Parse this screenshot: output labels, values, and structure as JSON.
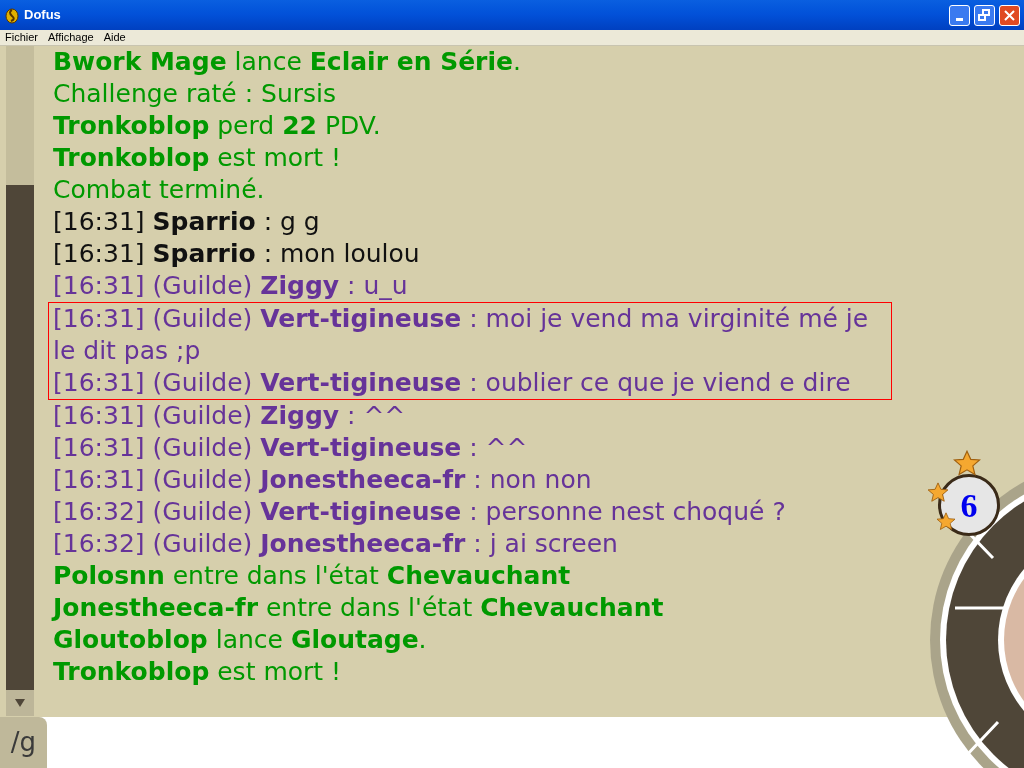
{
  "window": {
    "title": "Dofus"
  },
  "menu": [
    "Fichier",
    "Affichage",
    "Aide"
  ],
  "chat": [
    {
      "kind": "system",
      "text": "**Bwork Mage** lance **Eclair en Série**.",
      "highlighted": false
    },
    {
      "kind": "system",
      "text": "Challenge raté : Sursis",
      "highlighted": false
    },
    {
      "kind": "system",
      "text": "**Tronkoblop** perd **22** PDV.",
      "highlighted": false
    },
    {
      "kind": "system",
      "text": "**Tronkoblop** est mort !",
      "highlighted": false
    },
    {
      "kind": "system",
      "text": "Combat terminé.",
      "highlighted": false
    },
    {
      "kind": "general",
      "text": "[16:31] **Sparrio** : g g",
      "highlighted": false
    },
    {
      "kind": "general",
      "text": "[16:31] **Sparrio** : mon loulou",
      "highlighted": false
    },
    {
      "kind": "guild",
      "text": "[16:31] (Guilde) **Ziggy** : u_u",
      "highlighted": false
    },
    {
      "kind": "guild",
      "text": "[16:31] (Guilde) **Vert-tigineuse** : moi je vend ma virginité mé je le dit pas ;p",
      "highlighted": true
    },
    {
      "kind": "guild",
      "text": "[16:31] (Guilde) **Vert-tigineuse** : oublier ce que je viend e dire",
      "highlighted": true
    },
    {
      "kind": "guild",
      "text": "[16:31] (Guilde) **Ziggy** : ^^",
      "highlighted": false
    },
    {
      "kind": "guild",
      "text": "[16:31] (Guilde) **Vert-tigineuse** : ^^",
      "highlighted": false
    },
    {
      "kind": "guild",
      "text": "[16:31] (Guilde) **Jonestheeca-fr** : non non",
      "highlighted": false
    },
    {
      "kind": "guild",
      "text": "[16:32] (Guilde) **Vert-tigineuse** : personne nest choqué ?",
      "highlighted": false
    },
    {
      "kind": "guild",
      "text": "[16:32] (Guilde) **Jonestheeca-fr** : j ai screen",
      "highlighted": false
    },
    {
      "kind": "system",
      "text": "**Polosnn** entre dans l'état **Chevauchant**",
      "highlighted": false
    },
    {
      "kind": "system",
      "text": "**Jonestheeca-fr** entre dans l'état **Chevauchant**",
      "highlighted": false
    },
    {
      "kind": "system",
      "text": "**Gloutoblop** lance **Gloutage**.",
      "highlighted": false
    },
    {
      "kind": "system",
      "text": "**Tronkoblop** est mort !",
      "highlighted": false
    }
  ],
  "channel_tab": "/g",
  "level_badge": "6"
}
